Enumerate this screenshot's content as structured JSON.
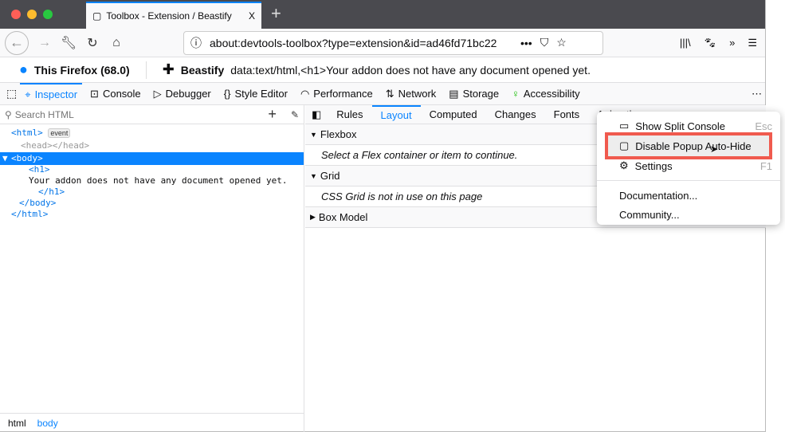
{
  "window": {
    "tab_title": "Toolbox - Extension / Beastify",
    "close": "X",
    "new_tab": "+"
  },
  "nav": {
    "url": "about:devtools-toolbox?type=extension&id=ad46fd71bc22",
    "more": "•••"
  },
  "target": {
    "firefox": "This Firefox (68.0)",
    "addon": "Beastify",
    "addon_url": "data:text/html,<h1>Your addon does not have any document opened yet."
  },
  "tools": [
    {
      "label": "Inspector",
      "icon": "inspector-icon"
    },
    {
      "label": "Console",
      "icon": "console-icon"
    },
    {
      "label": "Debugger",
      "icon": "debugger-icon"
    },
    {
      "label": "Style Editor",
      "icon": "braces-icon"
    },
    {
      "label": "Performance",
      "icon": "gauge-icon"
    },
    {
      "label": "Network",
      "icon": "arrows-icon"
    },
    {
      "label": "Storage",
      "icon": "storage-icon"
    },
    {
      "label": "Accessibility",
      "icon": "accessibility-icon"
    }
  ],
  "inspector": {
    "search_placeholder": "Search HTML",
    "event_badge": "event",
    "lines": {
      "html_open": "<html>",
      "head": "<head></head>",
      "body_open": "<body>",
      "h1_open": "<h1>",
      "text": "Your addon does not have any document opened yet.",
      "h1_close": "</h1>",
      "body_close": "</body>",
      "html_close": "</html>"
    },
    "breadcrumbs": [
      "html",
      "body"
    ]
  },
  "sidebar": {
    "tabs": [
      "Rules",
      "Layout",
      "Computed",
      "Changes",
      "Fonts",
      "Animations"
    ],
    "selected": "Layout",
    "flexbox": "Flexbox",
    "flex_msg": "Select a Flex container or item to continue.",
    "grid": "Grid",
    "grid_msg": "CSS Grid is not in use on this page",
    "boxmodel": "Box Model"
  },
  "menu": {
    "items": [
      {
        "label": "Show Split Console",
        "key": "Esc"
      },
      {
        "label": "Disable Popup Auto-Hide"
      },
      {
        "label": "Settings",
        "key": "F1"
      }
    ],
    "documentation": "Documentation...",
    "community": "Community..."
  },
  "colors": {
    "accent": "#0a84ff",
    "highlight": "#f05a4e"
  }
}
